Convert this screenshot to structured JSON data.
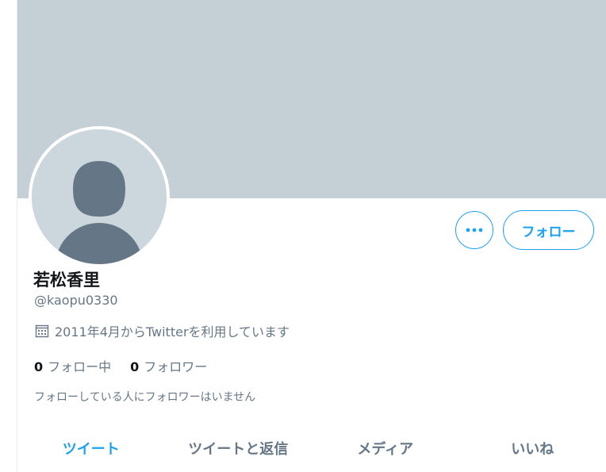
{
  "profile": {
    "display_name": "若松香里",
    "handle": "@kaopu0330",
    "joined": "2011年4月からTwitterを利用しています",
    "following_count": "0",
    "following_label": "フォロー中",
    "followers_count": "0",
    "followers_label": "フォロワー",
    "followed_by_note": "フォローしている人にフォロワーはいません"
  },
  "actions": {
    "follow_label": "フォロー",
    "more_icon": "more-dots-icon"
  },
  "icons": {
    "calendar": "calendar-icon",
    "avatar": "default-avatar-icon"
  },
  "tabs": [
    {
      "label": "ツイート",
      "active": true
    },
    {
      "label": "ツイートと返信",
      "active": false
    },
    {
      "label": "メディア",
      "active": false
    },
    {
      "label": "いいね",
      "active": false
    }
  ],
  "colors": {
    "accent": "#1da1f2",
    "banner": "#c4cfd6",
    "secondary_text": "#657786",
    "primary_text": "#14171a"
  }
}
